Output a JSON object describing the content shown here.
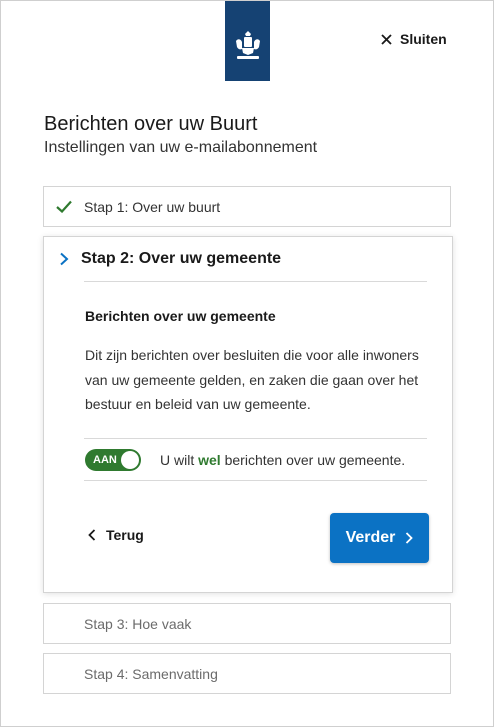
{
  "header": {
    "logo_icon": "rijksoverheid-coat-of-arms",
    "close_label": "Sluiten"
  },
  "page": {
    "title": "Berichten over uw Buurt",
    "subtitle": "Instellingen van uw e-mailabonnement"
  },
  "steps": [
    {
      "label": "Stap 1: Over uw buurt",
      "state": "completed"
    },
    {
      "label": "Stap 2: Over uw gemeente",
      "state": "active"
    },
    {
      "label": "Stap 3: Hoe vaak",
      "state": "upcoming"
    },
    {
      "label": "Stap 4: Samenvatting",
      "state": "upcoming"
    }
  ],
  "active_step": {
    "section_title": "Berichten over uw gemeente",
    "description": "Dit zijn berichten over besluiten die voor alle inwoners van uw gemeente gelden, en zaken die gaan over het bestuur en beleid van uw gemeente.",
    "toggle": {
      "label": "AAN",
      "on": true,
      "text_before": "U wilt ",
      "text_emphasis": "wel",
      "text_after": " berichten over uw gemeente."
    },
    "back_label": "Terug",
    "next_label": "Verder"
  },
  "colors": {
    "brand": "#154273",
    "accent_blue": "#0b72c4",
    "success_green": "#2f7a2f"
  }
}
